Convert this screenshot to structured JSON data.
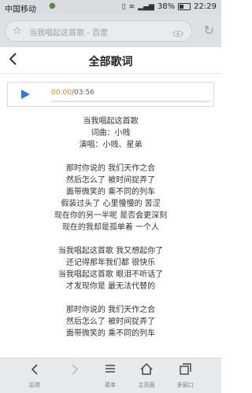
{
  "status_bar": {
    "carrier": "中国移动",
    "battery": "38%",
    "time": "22:29"
  },
  "browser": {
    "url_text": "当我唱起这首歌 - 百度"
  },
  "header": {
    "title": "全部歌词"
  },
  "player": {
    "current_time": "00:00",
    "duration": "/03:56",
    "progress_fraction": 0
  },
  "lyrics": [
    "当我唱起这首歌",
    "词曲：小贱",
    "演唱：小贱、星弟",
    "",
    "那时你说的 我们天作之合",
    "然后怎么了 被时间捉弄了",
    "面带微笑的 乘不同的列车",
    "假装过头了 心里慢慢的 苦涩",
    "现在你的另一半呢 是否会更深刻",
    "现在的我却是孤单着 一个人",
    "",
    "当我唱起这首歌 我又想起你了",
    "还记得那年我们都 很快乐",
    "当我唱起这首歌 眼泪不听话了",
    "才发现你是 最无法代替的",
    "",
    "那时你说的 我们天作之合",
    "然后怎么了 被时间捉弄了",
    "面带微笑的 乘不同的列车"
  ],
  "bottom_nav": {
    "items": [
      {
        "label": "后退",
        "icon": "back-arrow-icon"
      },
      {
        "label": "",
        "icon": "forward-arrow-icon"
      },
      {
        "label": "菜单",
        "icon": "menu-icon"
      },
      {
        "label": "主页面",
        "icon": "home-icon"
      },
      {
        "label": "多窗口",
        "icon": "windows-icon"
      }
    ]
  },
  "colors": {
    "accent_orange": "#e08a1e",
    "play_blue": "#2f7bd6"
  }
}
